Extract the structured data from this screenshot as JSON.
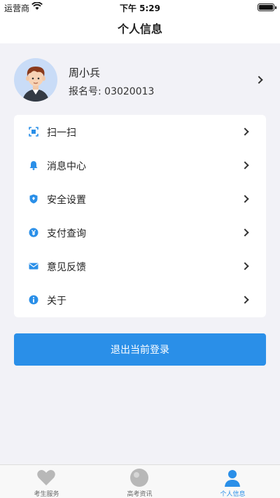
{
  "status_bar": {
    "carrier": "运营商",
    "time": "下午 5:29"
  },
  "nav": {
    "title": "个人信息"
  },
  "profile": {
    "name": "周小兵",
    "id_label": "报名号:",
    "id_value": "03020013"
  },
  "menu": {
    "items": [
      {
        "label": "扫一扫",
        "icon": "scan-icon"
      },
      {
        "label": "消息中心",
        "icon": "bell-icon"
      },
      {
        "label": "安全设置",
        "icon": "shield-icon"
      },
      {
        "label": "支付查询",
        "icon": "yen-icon"
      },
      {
        "label": "意见反馈",
        "icon": "mail-icon"
      },
      {
        "label": "关于",
        "icon": "info-icon"
      }
    ]
  },
  "logout": {
    "label": "退出当前登录"
  },
  "tabs": [
    {
      "label": "考生服务",
      "icon": "heart-icon"
    },
    {
      "label": "高考资讯",
      "icon": "globe-icon"
    },
    {
      "label": "个人信息",
      "icon": "person-icon",
      "active": true
    }
  ],
  "colors": {
    "accent": "#2a8fe8",
    "background": "#f2f2f7"
  }
}
